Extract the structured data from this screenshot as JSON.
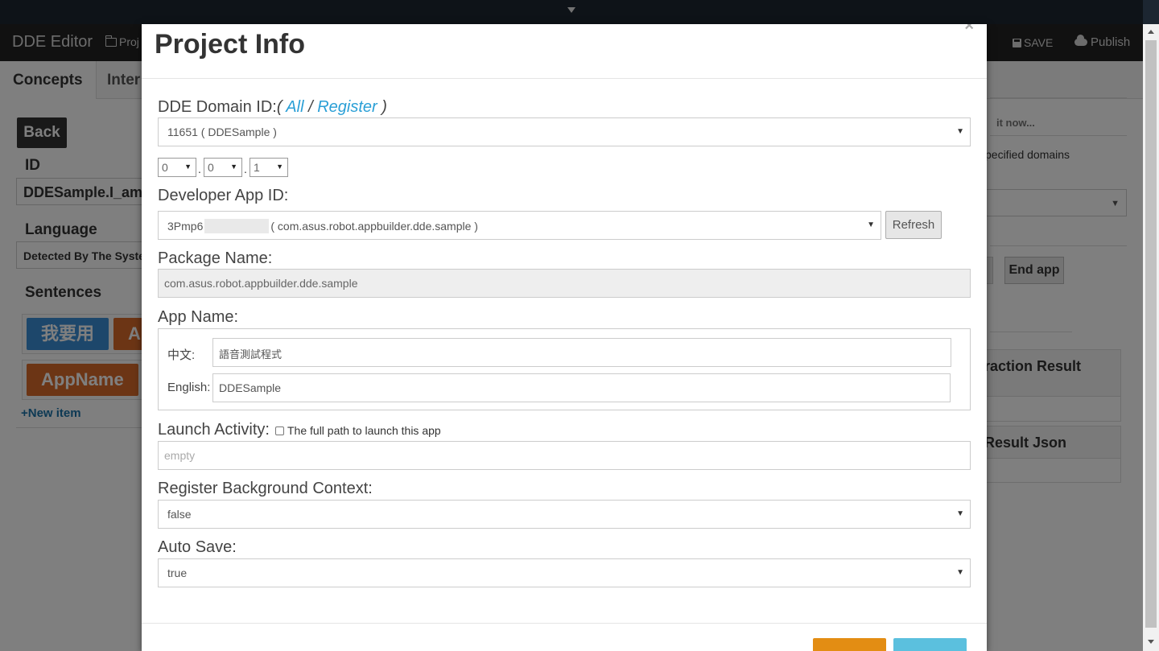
{
  "navbar": {
    "brand": "DDE Editor",
    "project_label": "Proj",
    "save_label": "SAVE",
    "publish_label": "Publish"
  },
  "tabs": [
    {
      "label": "Concepts"
    },
    {
      "label": "Inter"
    }
  ],
  "left_panel": {
    "back_label": "Back",
    "id_label": "ID",
    "id_value": "DDESample.I_am",
    "language_label": "Language",
    "language_value": "Detected By The Syste",
    "sentences_label": "Sentences",
    "sentence_items": [
      "我要用",
      "A",
      "AppName"
    ],
    "new_item_label": "+New item"
  },
  "right_panel": {
    "edit_now_text": "it now...",
    "specified_domains_text": "pecified domains",
    "end_app_label": "End app",
    "interaction_result_title": "raction Result",
    "result_json_title": "Result Json"
  },
  "modal": {
    "title": "Project Info",
    "close_symbol": "×",
    "domain_id_label": "DDE Domain ID:",
    "domain_paren_open": "( ",
    "domain_link_all": "All",
    "domain_sep": " / ",
    "domain_link_register": "Register",
    "domain_paren_close": " )",
    "domain_id_value": "11651 ( DDESample )",
    "version": [
      "0",
      "0",
      "1"
    ],
    "developer_app_id_label": "Developer App ID:",
    "developer_app_id_prefix": "3Pmp6",
    "developer_app_id_suffix": "( com.asus.robot.appbuilder.dde.sample )",
    "refresh_label": "Refresh",
    "package_name_label": "Package Name:",
    "package_name_value": "com.asus.robot.appbuilder.dde.sample",
    "app_name_label": "App Name:",
    "app_name_zh_label": "中文:",
    "app_name_zh_value": "語音測試程式",
    "app_name_en_label": "English:",
    "app_name_en_value": "DDESample",
    "launch_activity_label": "Launch Activity:",
    "launch_activity_checkbox_label": "The full path to launch this app",
    "launch_activity_placeholder": "empty",
    "register_bg_label": "Register Background Context:",
    "register_bg_value": "false",
    "auto_save_label": "Auto Save:",
    "auto_save_value": "true"
  },
  "colors": {
    "navbar_bg": "#222222",
    "link": "#2a9fd6",
    "footer_primary": "#e38d13",
    "footer_secondary": "#5bc0de"
  }
}
